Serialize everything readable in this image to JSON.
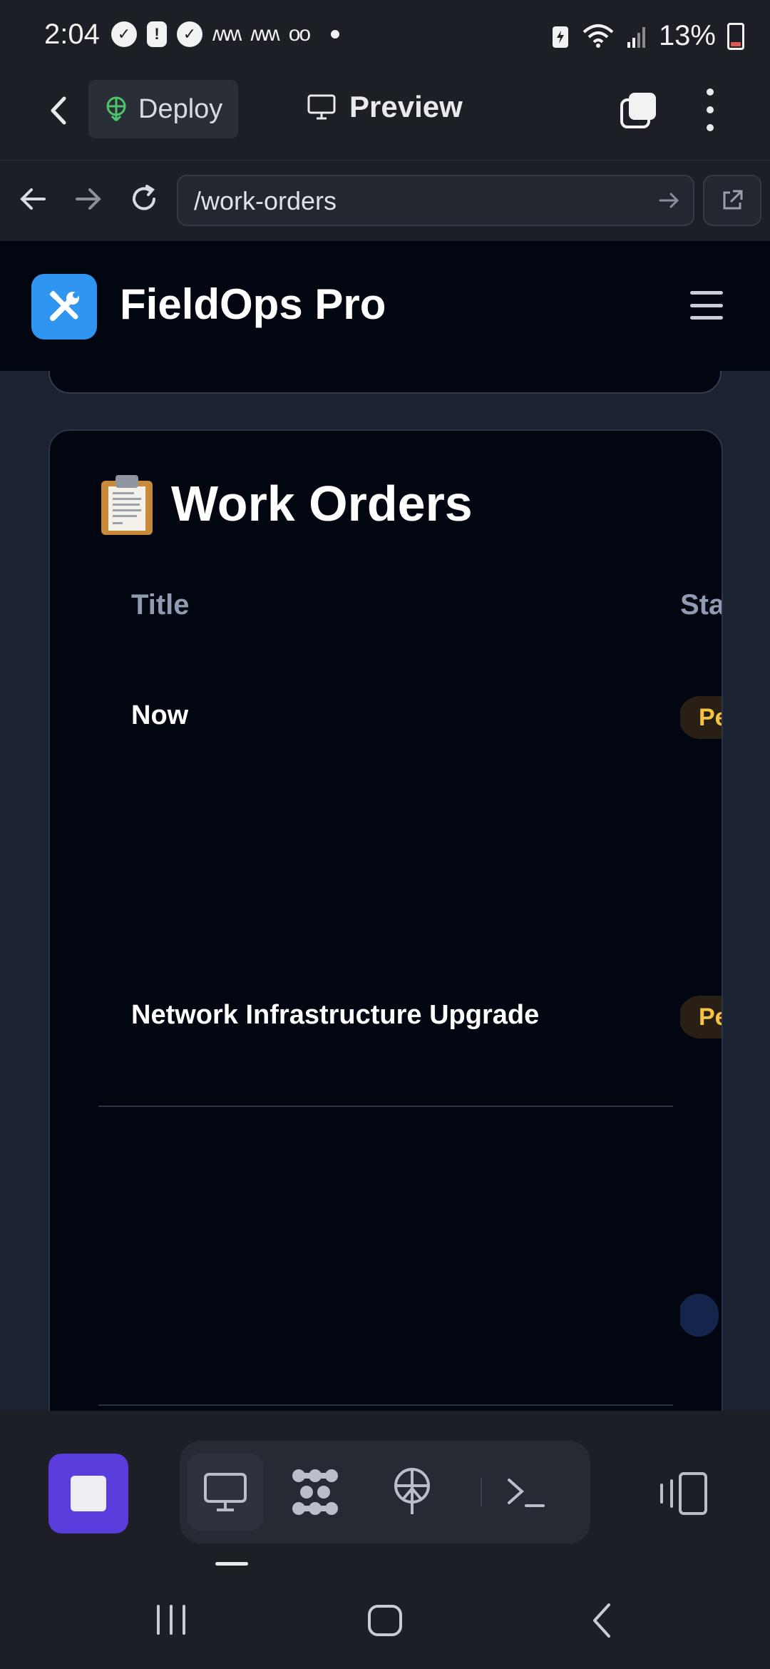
{
  "status_bar": {
    "time": "2:04",
    "battery": "13%",
    "left_icons": [
      "messenger-icon",
      "alert-icon",
      "messenger-icon",
      "wave-icon",
      "wave-icon",
      "voicemail-icon",
      "dot-icon"
    ],
    "right_icons": [
      "battery-saver-icon",
      "wifi-icon",
      "signal-icon",
      "battery-icon"
    ]
  },
  "toolbar": {
    "deploy_label": "Deploy",
    "preview_label": "Preview"
  },
  "browser": {
    "url": "/work-orders"
  },
  "site": {
    "brand": "FieldOps Pro",
    "logo_icon": "tools-icon",
    "accent": "#2f95f0"
  },
  "work_orders": {
    "heading": "Work Orders",
    "heading_icon": "clipboard-icon",
    "columns": [
      "Title",
      "Sta"
    ],
    "rows": [
      {
        "title": "Now",
        "status": "Pe",
        "status_color": "#f6c343"
      },
      {
        "title": "Network Infrastructure Upgrade",
        "status": "Pe",
        "status_color": "#f6c343"
      },
      {
        "title": "",
        "status": "",
        "status_color": "#6ea8ff"
      }
    ]
  },
  "bottom_bar": {
    "stop_color": "#5a3bdb",
    "tabs": [
      "monitor-icon",
      "cluster-icon",
      "deploy-icon",
      "terminal-icon"
    ],
    "active_tab": "monitor-icon",
    "devices_icon": "devices-icon"
  }
}
